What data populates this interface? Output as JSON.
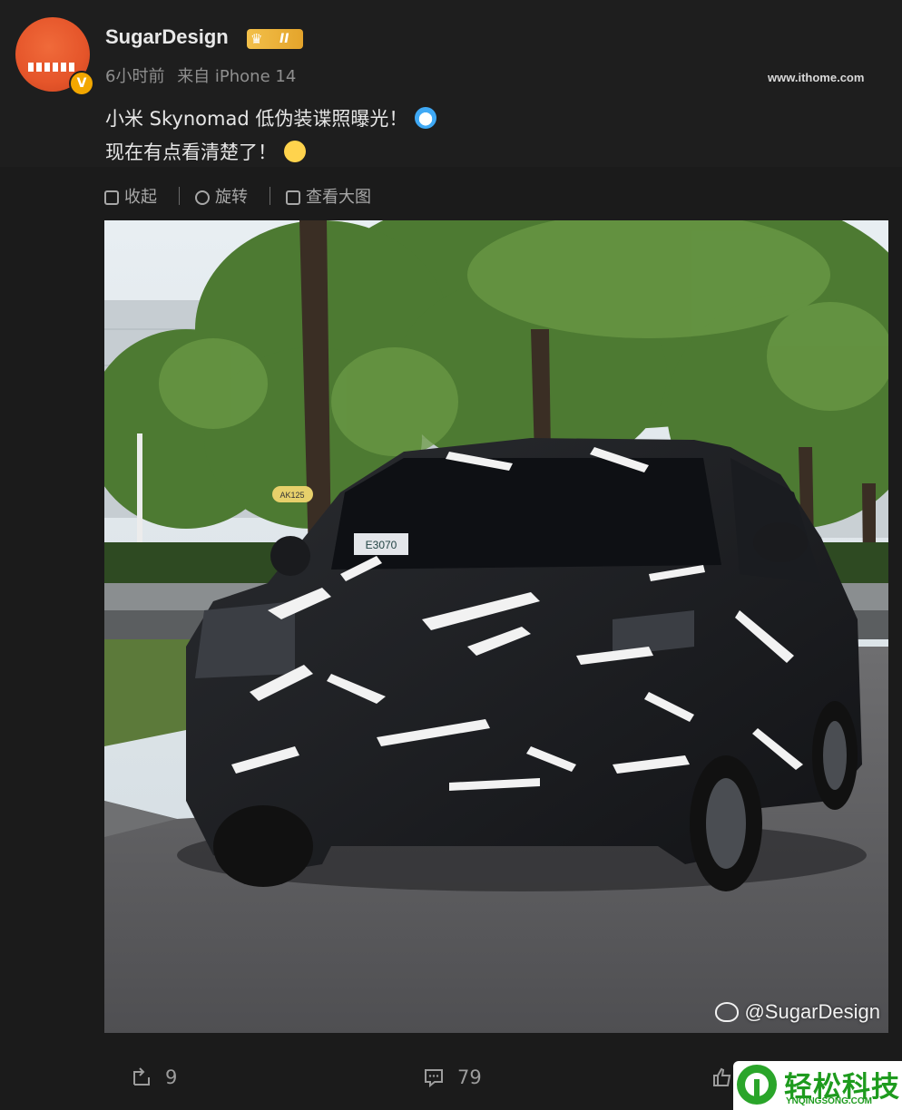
{
  "post": {
    "username": "SugarDesign",
    "level_badge": "II",
    "time": "6小时前",
    "source": "来自 iPhone 14",
    "line1": "小米 Skynomad 低伪装谍照曝光！",
    "line2": "现在有点看清楚了！",
    "site_watermark": "www.ithome.com"
  },
  "toolbar": {
    "collapse": "收起",
    "rotate": "旋转",
    "view_large": "查看大图"
  },
  "photo": {
    "watermark": "@SugarDesign",
    "plate_text": "E3070",
    "sticker_text": "AK125"
  },
  "actions": {
    "repost_count": "9",
    "comment_count": "79"
  },
  "brand": {
    "name_cn": "轻松科技",
    "name_en": "YNQINGSONG.COM"
  },
  "icons": [
    "collapse-icon",
    "rotate-icon",
    "image-icon",
    "repost-icon",
    "comment-icon",
    "like-icon",
    "weibo-logo-icon",
    "verified-icon",
    "crown-icon"
  ],
  "colors": {
    "background": "#1b1b1b",
    "accent_badge": "#f2a700",
    "brand_green": "#1e9b1e"
  }
}
